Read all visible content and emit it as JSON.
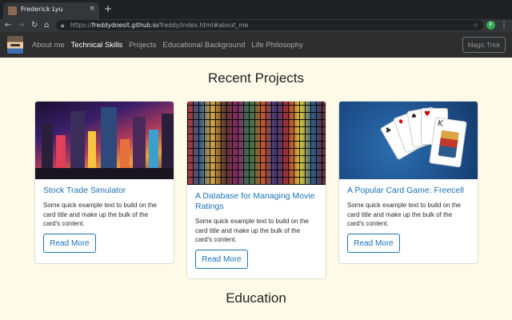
{
  "browser": {
    "tab_title": "Frederick Lyu",
    "tab_close": "×",
    "new_tab": "+",
    "url_scheme": "https://",
    "url_host": "freddydoesit.github.io",
    "url_path": "/freddy/index.html#about_me",
    "profile_initial": "F"
  },
  "nav": {
    "links": [
      "About me",
      "Technical Skills",
      "Projects",
      "Educational Background",
      "Life Philosophy"
    ],
    "active_link": "Technical Skills",
    "button": "Magic Trick"
  },
  "projects": {
    "title": "Recent Projects",
    "cards": [
      {
        "title": "Stock Trade Simulator",
        "text": "Some quick example text to build on the card title and make up the bulk of the card's content.",
        "button": "Read More"
      },
      {
        "title": "A Database for Managing Movie Ratings",
        "text": "Some quick example text to build on the card title and make up the bulk of the card's content.",
        "button": "Read More"
      },
      {
        "title": "A Popular Card Game: Freecell",
        "text": "Some quick example text to build on the card title and make up the bulk of the card's content.",
        "button": "Read More"
      }
    ]
  },
  "education": {
    "title": "Education"
  },
  "colors": {
    "page_bg": "#fdfbe8",
    "navbar_bg": "#2e2e2e",
    "accent": "#1a73b8"
  },
  "icons": {
    "back": "arrow-left-icon",
    "forward": "arrow-right-icon",
    "reload": "reload-icon",
    "home": "home-icon",
    "lock": "lock-icon",
    "star": "star-icon",
    "menu": "kebab-menu-icon"
  }
}
